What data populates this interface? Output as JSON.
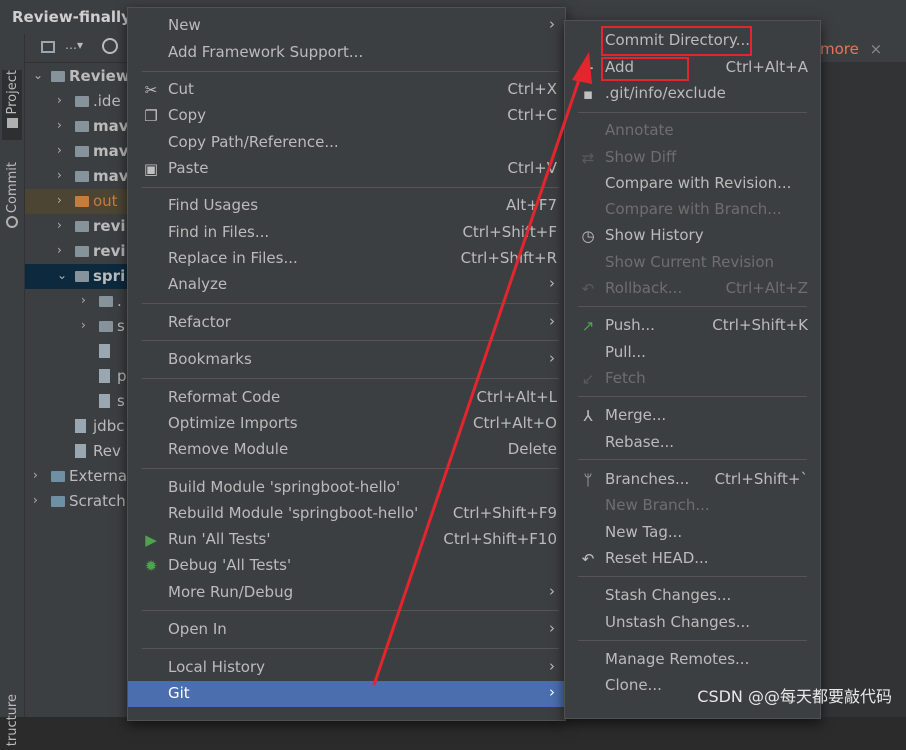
{
  "window": {
    "title": "Review-finally"
  },
  "tool_windows": {
    "project": "Project",
    "commit": "Commit",
    "structure": "tructure"
  },
  "project_tree": {
    "rows": [
      {
        "label": "Review",
        "style": "bold"
      },
      {
        "label": ".ide",
        "style": "normal"
      },
      {
        "label": "mav",
        "style": "bold"
      },
      {
        "label": "mav",
        "style": "bold"
      },
      {
        "label": "mav",
        "style": "bold"
      },
      {
        "label": "out",
        "style": "orange"
      },
      {
        "label": "revi",
        "style": "bold"
      },
      {
        "label": "revi",
        "style": "bold"
      },
      {
        "label": "spri",
        "style": "bold"
      },
      {
        "label": ".",
        "style": "normal"
      },
      {
        "label": "s",
        "style": "normal"
      },
      {
        "label": "",
        "style": "normal"
      },
      {
        "label": "p",
        "style": "normal"
      },
      {
        "label": "s",
        "style": "normal"
      },
      {
        "label": "jdbc",
        "style": "normal"
      },
      {
        "label": "Rev",
        "style": "normal"
      },
      {
        "label": "Externa",
        "style": "normal"
      },
      {
        "label": "Scratch",
        "style": "normal"
      }
    ]
  },
  "editor": {
    "tab_label": "more"
  },
  "context_menu": {
    "items": [
      {
        "label": "New",
        "shortcut": "",
        "submenu": true
      },
      {
        "label": "Add Framework Support...",
        "shortcut": ""
      },
      {
        "label": "Cut",
        "shortcut": "Ctrl+X",
        "icon": "scissors-icon"
      },
      {
        "label": "Copy",
        "shortcut": "Ctrl+C",
        "icon": "copy-icon"
      },
      {
        "label": "Copy Path/Reference...",
        "shortcut": ""
      },
      {
        "label": "Paste",
        "shortcut": "Ctrl+V",
        "icon": "clipboard-icon"
      },
      {
        "label": "Find Usages",
        "shortcut": "Alt+F7"
      },
      {
        "label": "Find in Files...",
        "shortcut": "Ctrl+Shift+F"
      },
      {
        "label": "Replace in Files...",
        "shortcut": "Ctrl+Shift+R"
      },
      {
        "label": "Analyze",
        "shortcut": "",
        "submenu": true
      },
      {
        "label": "Refactor",
        "shortcut": "",
        "submenu": true
      },
      {
        "label": "Bookmarks",
        "shortcut": "",
        "submenu": true
      },
      {
        "label": "Reformat Code",
        "shortcut": "Ctrl+Alt+L"
      },
      {
        "label": "Optimize Imports",
        "shortcut": "Ctrl+Alt+O"
      },
      {
        "label": "Remove Module",
        "shortcut": "Delete"
      },
      {
        "label": "Build Module 'springboot-hello'",
        "shortcut": ""
      },
      {
        "label": "Rebuild Module 'springboot-hello'",
        "shortcut": "Ctrl+Shift+F9"
      },
      {
        "label": "Run 'All Tests'",
        "shortcut": "Ctrl+Shift+F10",
        "icon": "run-icon"
      },
      {
        "label": "Debug 'All Tests'",
        "shortcut": "",
        "icon": "debug-icon"
      },
      {
        "label": "More Run/Debug",
        "shortcut": "",
        "submenu": true
      },
      {
        "label": "Open In",
        "shortcut": "",
        "submenu": true
      },
      {
        "label": "Local History",
        "shortcut": "",
        "submenu": true
      },
      {
        "label": "Git",
        "shortcut": "",
        "submenu": true,
        "selected": true
      }
    ]
  },
  "git_menu": {
    "items": [
      {
        "label": "Commit Directory...",
        "shortcut": ""
      },
      {
        "label": "Add",
        "shortcut": "Ctrl+Alt+A",
        "icon": "plus-icon"
      },
      {
        "label": ".git/info/exclude",
        "shortcut": "",
        "icon": "git-file-icon"
      },
      {
        "label": "Annotate",
        "shortcut": "",
        "disabled": true
      },
      {
        "label": "Show Diff",
        "shortcut": "",
        "disabled": true,
        "icon": "diff-icon"
      },
      {
        "label": "Compare with Revision...",
        "shortcut": ""
      },
      {
        "label": "Compare with Branch...",
        "shortcut": "",
        "disabled": true
      },
      {
        "label": "Show History",
        "shortcut": "",
        "icon": "clock-icon"
      },
      {
        "label": "Show Current Revision",
        "shortcut": "",
        "disabled": true
      },
      {
        "label": "Rollback...",
        "shortcut": "Ctrl+Alt+Z",
        "disabled": true,
        "icon": "undo-icon"
      },
      {
        "label": "Push...",
        "shortcut": "Ctrl+Shift+K",
        "icon": "push-arrow-icon"
      },
      {
        "label": "Pull...",
        "shortcut": ""
      },
      {
        "label": "Fetch",
        "shortcut": "",
        "disabled": true,
        "icon": "fetch-icon"
      },
      {
        "label": "Merge...",
        "shortcut": "",
        "icon": "merge-icon"
      },
      {
        "label": "Rebase...",
        "shortcut": ""
      },
      {
        "label": "Branches...",
        "shortcut": "Ctrl+Shift+`",
        "icon": "branch-icon"
      },
      {
        "label": "New Branch...",
        "shortcut": "",
        "disabled": true
      },
      {
        "label": "New Tag...",
        "shortcut": ""
      },
      {
        "label": "Reset HEAD...",
        "shortcut": "",
        "icon": "reset-icon"
      },
      {
        "label": "Stash Changes...",
        "shortcut": ""
      },
      {
        "label": "Unstash Changes...",
        "shortcut": ""
      },
      {
        "label": "Manage Remotes...",
        "shortcut": ""
      },
      {
        "label": "Clone...",
        "shortcut": ""
      }
    ]
  },
  "annotations": {
    "highlight_color": "#e3262d",
    "highlighted_items": [
      "Commit Directory...",
      "Add"
    ]
  },
  "watermark": "CSDN @@每天都要敲代码",
  "colors": {
    "menu_bg": "#3c3f41",
    "selection": "#4b6eaf",
    "text": "#bbbbbb",
    "disabled_text": "#6e6e6e"
  }
}
